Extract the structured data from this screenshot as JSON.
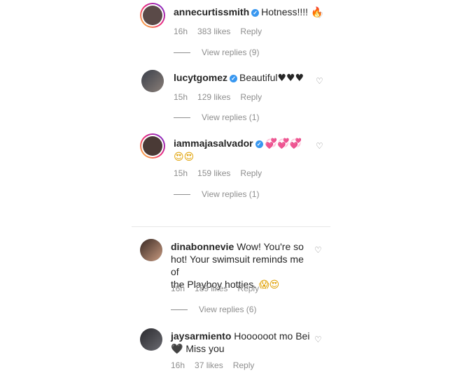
{
  "comments": [
    {
      "username": "annecurtissmith",
      "verified": true,
      "text": "Hotness!!!!",
      "emoji": "🔥",
      "time": "16h",
      "likes": "383 likes",
      "reply": "Reply",
      "view_replies": "View replies (9)"
    },
    {
      "username": "lucytgomez",
      "verified": true,
      "text": "Beautiful",
      "emoji": "♥♥♥",
      "time": "15h",
      "likes": "129 likes",
      "reply": "Reply",
      "view_replies": "View replies (1)"
    },
    {
      "username": "iammajasalvador",
      "verified": true,
      "text": "",
      "emoji": "💞💞💞",
      "emoji_line2": "😍😍",
      "time": "15h",
      "likes": "159 likes",
      "reply": "Reply",
      "view_replies": "View replies (1)"
    },
    {
      "username": "dinabonnevie",
      "verified": false,
      "text_line1": "Wow! You're so",
      "text_line2": "hot! Your swimsuit reminds me of",
      "text_line3": "the Playboy hotties.",
      "emoji": "😱😍",
      "time": "16h",
      "likes": "189 likes",
      "reply": "Reply",
      "view_replies": "View replies (6)"
    },
    {
      "username": "jaysarmiento",
      "verified": false,
      "text": "Hoooooot mo Bei",
      "text_line2": "Miss you",
      "emoji": "🖤",
      "time": "16h",
      "likes": "37 likes",
      "reply": "Reply"
    }
  ],
  "colors": {
    "verified": "#3897f0",
    "meta": "#8e8e8e",
    "text": "#262626"
  },
  "icons": {
    "like": "heart-outline-icon",
    "verified": "verified-badge-icon"
  }
}
